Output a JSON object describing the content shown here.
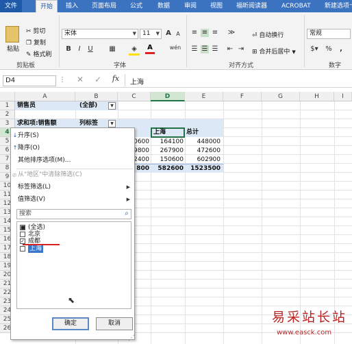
{
  "ribbon_tabs": [
    "文件",
    "开始",
    "插入",
    "页面布局",
    "公式",
    "数据",
    "审阅",
    "视图",
    "福昕阅读器",
    "ACROBAT",
    "新建选项卡"
  ],
  "clipboard": {
    "paste": "粘贴",
    "cut": "剪切",
    "copy": "复制",
    "painter": "格式刷",
    "group": "剪贴板"
  },
  "font": {
    "name": "宋体",
    "size": "11",
    "group": "字体",
    "bold": "B",
    "italic": "I",
    "underline": "U",
    "grow": "A",
    "shrink": "A",
    "color_letter": "A"
  },
  "alignment": {
    "wrap": "自动换行",
    "merge": "合并后居中",
    "group": "对齐方式"
  },
  "number": {
    "format": "常规",
    "percent": "%",
    "comma": ",",
    "group": "数字"
  },
  "formula_bar": {
    "name_box": "D4",
    "fx": "fx",
    "value": "上海"
  },
  "columns": [
    "A",
    "B",
    "C",
    "D",
    "E",
    "F",
    "G",
    "H",
    "I"
  ],
  "rows": [
    "1",
    "2",
    "3",
    "4",
    "5",
    "6",
    "7",
    "8",
    "9",
    "10",
    "11",
    "12",
    "13",
    "14",
    "15",
    "16",
    "17",
    "18",
    "19",
    "20",
    "21",
    "22",
    "23",
    "24",
    "25",
    "26"
  ],
  "cells": {
    "a1": "销售员",
    "b1": "(全部)",
    "a3": "求和项:销售额",
    "b3": "列标签",
    "d4": "上海",
    "e4": "总计",
    "c5": "0600",
    "d5": "164100",
    "e5": "448000",
    "c6": "9800",
    "d6": "267900",
    "e6": "472600",
    "c7": "2400",
    "d7": "150600",
    "e7": "602900",
    "c8": "800",
    "d8": "582600",
    "e8": "1523500"
  },
  "filter_menu": {
    "sort_asc": "升序(S)",
    "sort_desc": "降序(O)",
    "more_sort": "其他排序选项(M)...",
    "clear_filter": "从\"地区\"中清除筛选(C)",
    "label_filter": "标签筛选(L)",
    "value_filter": "值筛选(V)",
    "search_placeholder": "搜索",
    "items": [
      {
        "label": "(全选)",
        "state": "partial"
      },
      {
        "label": "北京",
        "state": "unchecked"
      },
      {
        "label": "成都",
        "state": "checked"
      },
      {
        "label": "上海",
        "state": "selected"
      }
    ],
    "ok": "确定",
    "cancel": "取消"
  },
  "watermark": {
    "title": "易采站长站",
    "url": "www.easck.com"
  },
  "colors": {
    "ribbon_blue": "#3c73c0",
    "header_fill": "#dce8f5",
    "selection": "#217346",
    "watermark": "#b22222"
  }
}
